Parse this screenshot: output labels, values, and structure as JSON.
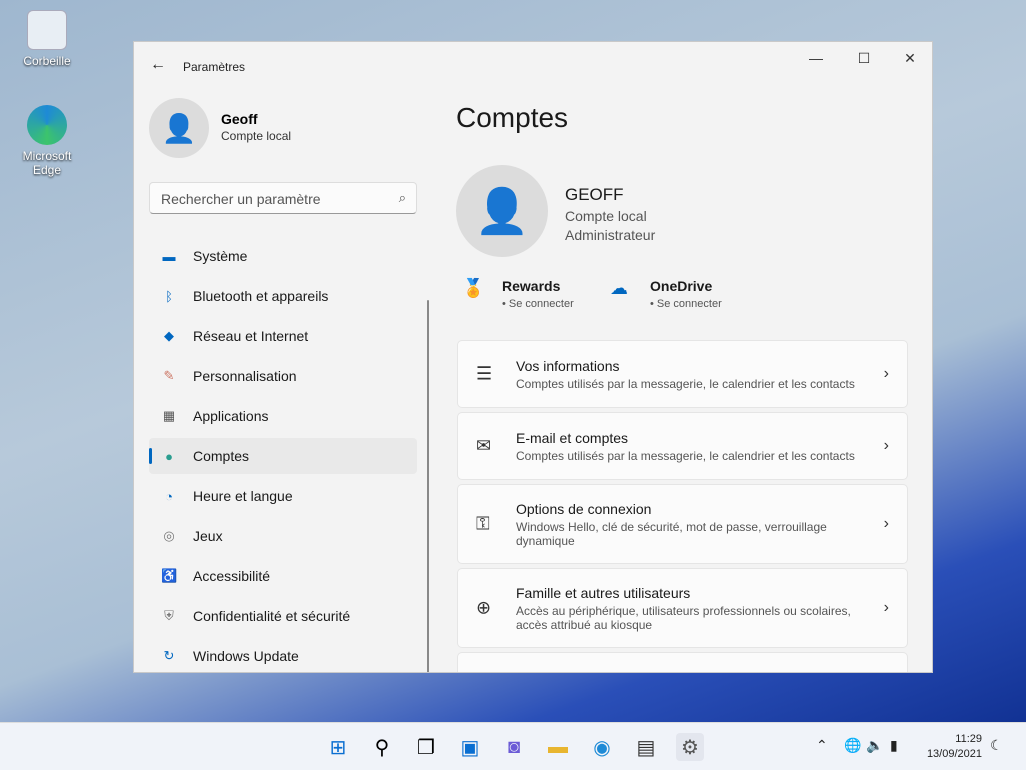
{
  "desktop": {
    "icons": [
      {
        "label": "Corbeille"
      },
      {
        "label": "Microsoft Edge"
      }
    ]
  },
  "window": {
    "title": "Paramètres",
    "controls": {
      "minimize": "—",
      "maximize": "☐",
      "close": "✕"
    }
  },
  "sidebar": {
    "user": {
      "name": "Geoff",
      "type": "Compte local"
    },
    "search": {
      "placeholder": "Rechercher un paramètre"
    },
    "items": [
      {
        "label": "Système",
        "icon": "▬"
      },
      {
        "label": "Bluetooth et appareils",
        "icon": "ᛒ"
      },
      {
        "label": "Réseau et Internet",
        "icon": "◆"
      },
      {
        "label": "Personnalisation",
        "icon": "✎"
      },
      {
        "label": "Applications",
        "icon": "▦"
      },
      {
        "label": "Comptes",
        "icon": "●",
        "active": true
      },
      {
        "label": "Heure et langue",
        "icon": "◔"
      },
      {
        "label": "Jeux",
        "icon": "◎"
      },
      {
        "label": "Accessibilité",
        "icon": "♿"
      },
      {
        "label": "Confidentialité et sécurité",
        "icon": "⛨"
      },
      {
        "label": "Windows Update",
        "icon": "↻"
      }
    ]
  },
  "main": {
    "title": "Comptes",
    "profile": {
      "name": "GEOFF",
      "type": "Compte local",
      "role": "Administrateur"
    },
    "services": [
      {
        "name": "Rewards",
        "status": "Se connecter"
      },
      {
        "name": "OneDrive",
        "status": "Se connecter"
      }
    ],
    "cards": [
      {
        "title": "Vos informations",
        "desc": "Comptes utilisés par la messagerie, le calendrier et les contacts"
      },
      {
        "title": "E-mail et comptes",
        "desc": "Comptes utilisés par la messagerie, le calendrier et les contacts"
      },
      {
        "title": "Options de connexion",
        "desc": "Windows Hello, clé de sécurité, mot de passe, verrouillage dynamique"
      },
      {
        "title": "Famille et autres utilisateurs",
        "desc": "Accès au périphérique, utilisateurs professionnels ou scolaires, accès attribué au kiosque"
      }
    ]
  },
  "taskbar": {
    "time": "11:29",
    "date": "13/09/2021"
  },
  "colors": {
    "accent": "#0067c0"
  }
}
